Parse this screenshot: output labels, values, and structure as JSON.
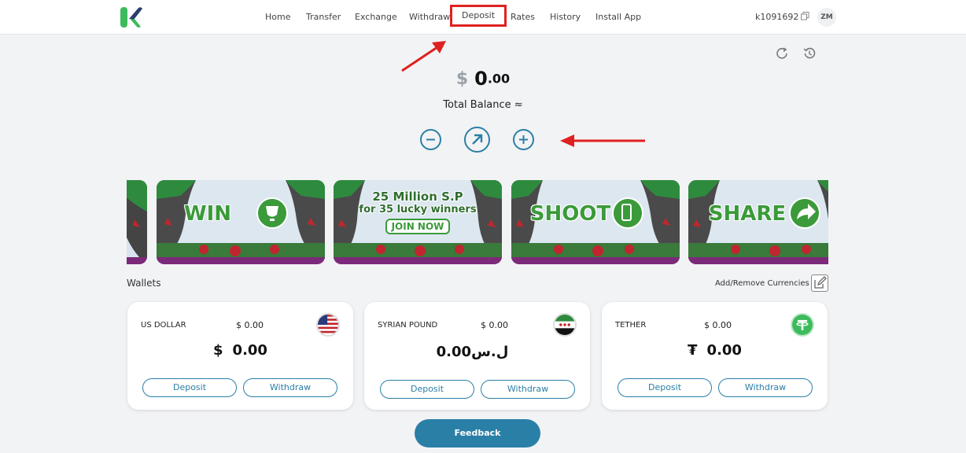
{
  "nav": {
    "items": [
      "Home",
      "Transfer",
      "Exchange",
      "Withdraw",
      "Deposit",
      "Rates",
      "History",
      "Install App"
    ],
    "user_id": "k1091692",
    "avatar_initials": "ZM"
  },
  "balance": {
    "currency_symbol": "$",
    "integer": "0",
    "decimal": ".00",
    "label": "Total Balance ≈"
  },
  "banners": [
    {
      "text": "WIN",
      "icon": "trophy-icon"
    },
    {
      "text": "25 Million S.P",
      "sub": "for 35 lucky winners",
      "button": "JOIN NOW"
    },
    {
      "text": "SHOOT",
      "icon": "phone-icon"
    },
    {
      "text": "SHARE",
      "icon": "share-arrow-icon"
    }
  ],
  "wallets": {
    "title": "Wallets",
    "add_remove": "Add/Remove Currencies",
    "cards": [
      {
        "name": "US DOLLAR",
        "small_balance": "$ 0.00",
        "symbol": "$",
        "amount": "0.00",
        "deposit": "Deposit",
        "withdraw": "Withdraw",
        "flag": "us-flag-icon"
      },
      {
        "name": "SYRIAN POUND",
        "small_balance": "$ 0.00",
        "symbol": "ل.س",
        "amount": "0.00",
        "deposit": "Deposit",
        "withdraw": "Withdraw",
        "flag": "syria-flag-icon"
      },
      {
        "name": "TETHER",
        "small_balance": "$ 0.00",
        "symbol": "₮",
        "amount": "0.00",
        "deposit": "Deposit",
        "withdraw": "Withdraw",
        "flag": "tether-icon"
      }
    ]
  },
  "feedback_label": "Feedback",
  "colors": {
    "accent": "#2a7fa6",
    "highlight": "#e02020",
    "banner_green": "#3b9a3a"
  }
}
